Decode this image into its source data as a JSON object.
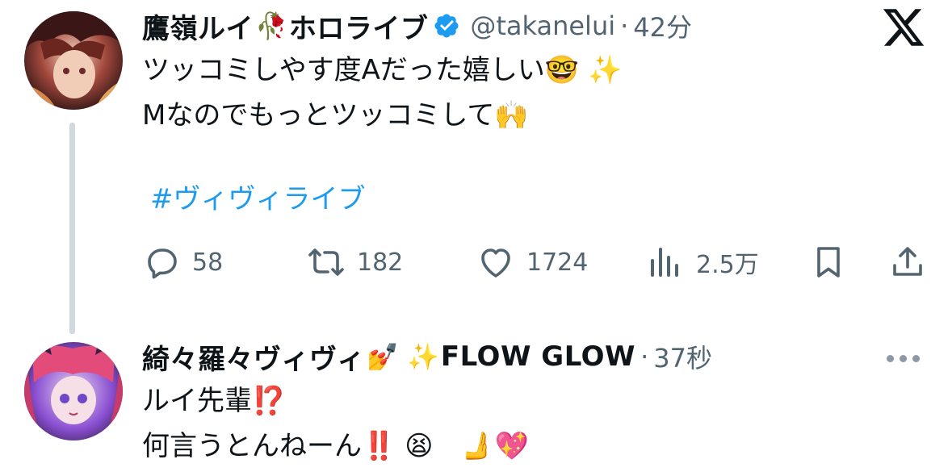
{
  "tweets": [
    {
      "display_name": "鷹嶺ルイ",
      "name_emoji": "🥀",
      "name_suffix": "ホロライブ",
      "handle": "@takanelui",
      "separator": "·",
      "time": "42分",
      "lines": [
        "ツッコミしやす度Aだった嬉しい🤓 ✨",
        "Mなのでもっとツッコミして🙌"
      ],
      "hashtag": "#ヴィヴィライブ",
      "actions": {
        "reply_count": "58",
        "retweet_count": "182",
        "like_count": "1724",
        "view_count": "2.5万"
      }
    },
    {
      "display_name": "綺々羅々ヴィヴィ",
      "name_emoji": "💅 ✨",
      "name_suffix": "FLOW GLOW",
      "separator": "·",
      "time": "37秒",
      "lines": [
        "ルイ先輩⁉️",
        "何言うとんねーん‼️ 😫　🫸💖"
      ]
    }
  ],
  "icons": {
    "verified": "verified-badge-icon",
    "x_logo": "x-logo-icon",
    "reply": "reply-icon",
    "retweet": "retweet-icon",
    "like": "heart-icon",
    "views": "views-icon",
    "bookmark": "bookmark-icon",
    "share": "share-icon",
    "more": "more-icon"
  },
  "colors": {
    "text": "#0f1419",
    "secondary": "#536471",
    "link": "#1d9bf0",
    "verified": "#1d9bf0",
    "thread_line": "#cfd9de"
  }
}
